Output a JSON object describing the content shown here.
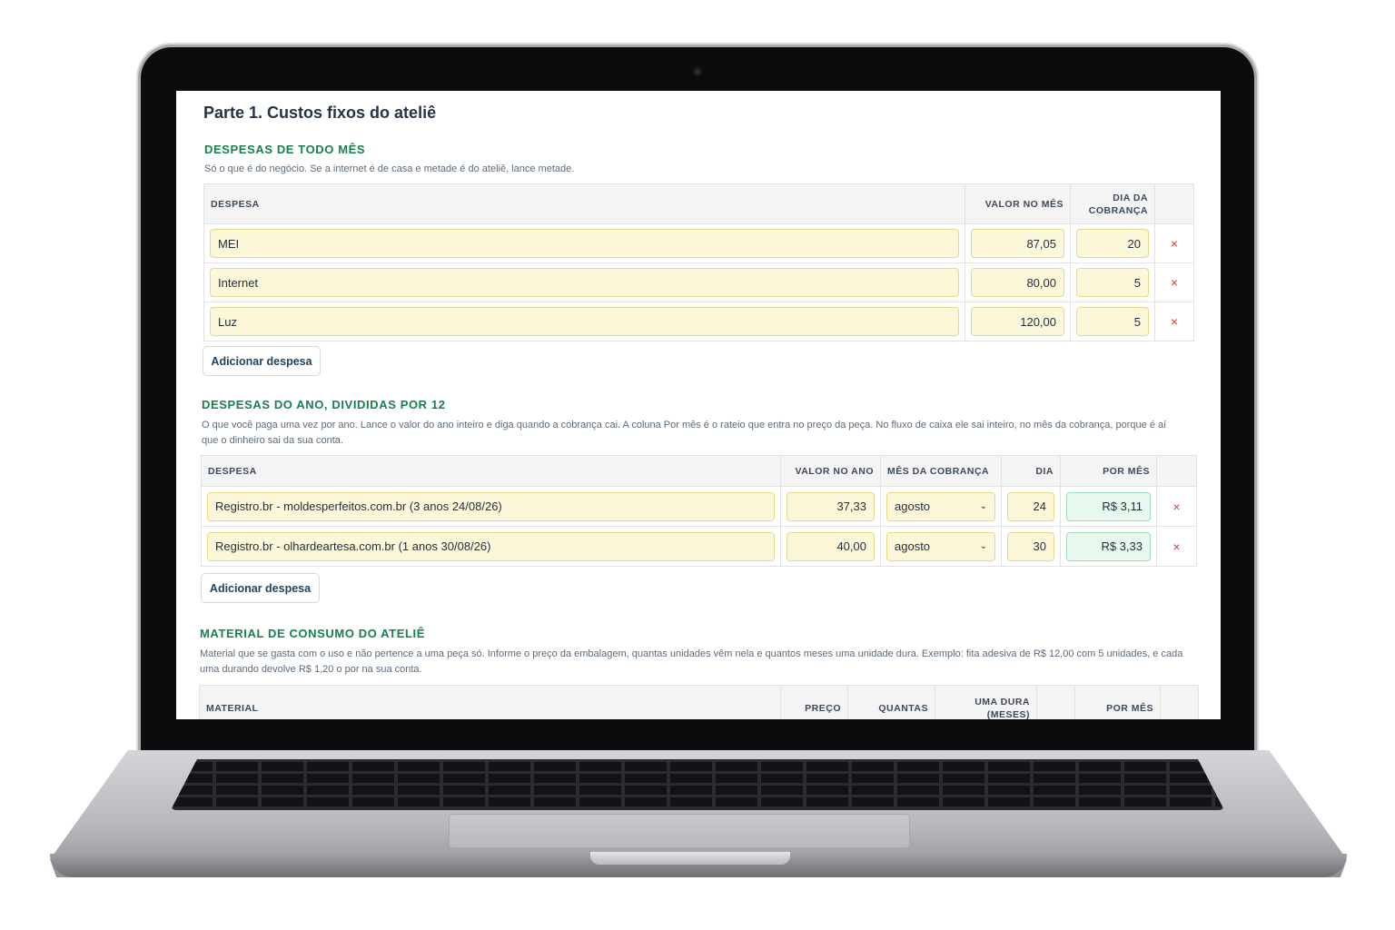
{
  "page": {
    "title": "Parte 1. Custos fixos do ateliê"
  },
  "monthly": {
    "title": "DESPESAS DE TODO MÊS",
    "desc": "Só o que é do negócio. Se a internet é de casa e metade é do ateliê, lance metade.",
    "headers": {
      "despesa": "DESPESA",
      "valor": "VALOR NO MÊS",
      "dia": "DIA DA COBRANÇA"
    },
    "rows": [
      {
        "despesa": "MEI",
        "valor": "87,05",
        "dia": "20"
      },
      {
        "despesa": "Internet",
        "valor": "80,00",
        "dia": "5"
      },
      {
        "despesa": "Luz",
        "valor": "120,00",
        "dia": "5"
      }
    ],
    "add_label": "Adicionar despesa",
    "delete_glyph": "×"
  },
  "yearly": {
    "title": "DESPESAS DO ANO, DIVIDIDAS POR 12",
    "desc": "O que você paga uma vez por ano. Lance o valor do ano inteiro e diga quando a cobrança cai. A coluna Por mês é o rateio que entra no preço da peça. No fluxo de caixa ele sai inteiro, no mês da cobrança, porque é aí que o dinheiro sai da sua conta.",
    "headers": {
      "despesa": "DESPESA",
      "valor": "VALOR NO ANO",
      "mes": "MÊS DA COBRANÇA",
      "dia": "DIA",
      "por_mes": "POR MÊS"
    },
    "rows": [
      {
        "despesa": "Registro.br - moldesperfeitos.com.br (3 anos 24/08/26)",
        "valor": "37,33",
        "mes": "agosto",
        "dia": "24",
        "por_mes": "R$ 3,11"
      },
      {
        "despesa": "Registro.br - olhardeartesa.com.br (1 anos 30/08/26)",
        "valor": "40,00",
        "mes": "agosto",
        "dia": "30",
        "por_mes": "R$ 3,33"
      }
    ],
    "add_label": "Adicionar despesa",
    "delete_glyph": "×"
  },
  "material": {
    "title": "MATERIAL DE CONSUMO DO ATELIÊ",
    "desc": "Material que se gasta com o uso e não pertence a uma peça só. Informe o preço da embalagem, quantas unidades vêm nela e quantos meses uma unidade dura. Exemplo: fita adesiva de R$ 12,00 com 5 unidades, e cada uma durando devolve R$ 1,20 o por na sua conta.",
    "headers": {
      "material": "MATERIAL",
      "preco": "PREÇO",
      "quantas": "QUANTAS",
      "dura": "UMA DURA (MESES)",
      "por_mes": "POR MÊS"
    }
  },
  "icons": {
    "select_chevron": "chevron-down-icon",
    "delete": "close-icon"
  },
  "colors": {
    "section_title": "#17804f",
    "input_bg": "#fdf7d9",
    "calc_bg": "#e7f8ef",
    "delete": "#d93b3b",
    "heading": "#243447"
  }
}
